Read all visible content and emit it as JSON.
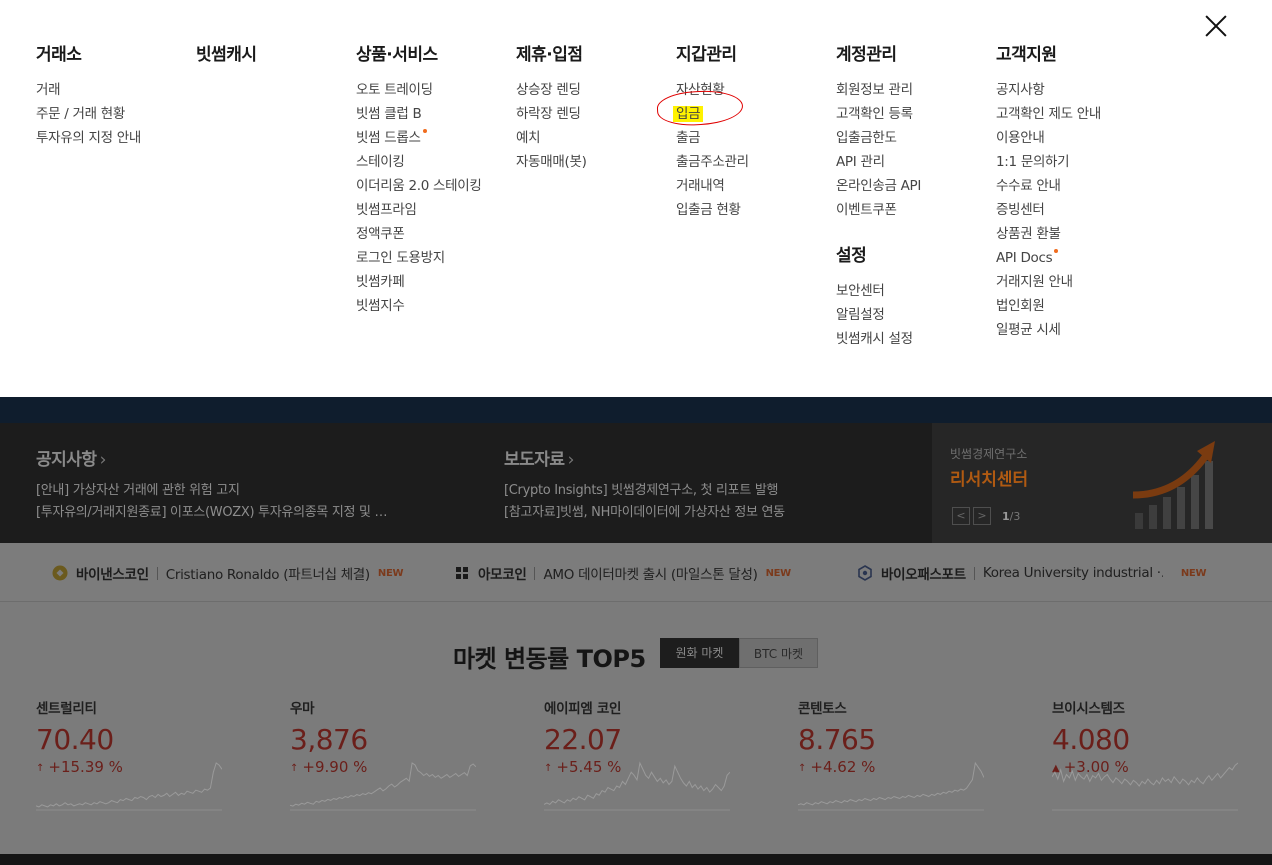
{
  "menu": {
    "columns": [
      {
        "title": "거래소",
        "items": [
          "거래",
          "주문 / 거래 현황",
          "투자유의 지정 안내"
        ]
      },
      {
        "title": "빗썸캐시",
        "items": []
      },
      {
        "title": "상품·서비스",
        "items": [
          "오토 트레이딩",
          "빗썸 클럽 B",
          "빗썸 드롭스",
          "스테이킹",
          "이더리움 2.0 스테이킹",
          "빗썸프라임",
          "정액쿠폰",
          "로그인 도용방지",
          "빗썸카페",
          "빗썸지수"
        ]
      },
      {
        "title": "제휴·입점",
        "items": [
          "상승장 렌딩",
          "하락장 렌딩",
          "예치",
          "자동매매(봇)"
        ]
      },
      {
        "title": "지갑관리",
        "items": [
          "자산현황",
          "입금",
          "출금",
          "출금주소관리",
          "거래내역",
          "입출금 현황"
        ]
      },
      {
        "title": "계정관리",
        "items": [
          "회원정보 관리",
          "고객확인 등록",
          "입출금한도",
          "API 관리",
          "온라인송금 API",
          "이벤트쿠폰"
        ],
        "sub_title": "설정",
        "sub_items": [
          "보안센터",
          "알림설정",
          "빗썸캐시 설정"
        ]
      },
      {
        "title": "고객지원",
        "items": [
          "공지사항",
          "고객확인 제도 안내",
          "이용안내",
          "1:1 문의하기",
          "수수료 안내",
          "증빙센터",
          "상품권 환불",
          "API Docs",
          "거래지원 안내",
          "법인회원",
          "일평균 시세"
        ]
      }
    ],
    "close_icon": "close-icon",
    "highlight_color": "#fff200",
    "annotation_color": "#e00000",
    "dot_color": "#f06c1e"
  },
  "news": {
    "notice": {
      "title": "공지사항",
      "lines": [
        "[안내] 가상자산 거래에 관한 위험 고지",
        "[투자유의/거래지원종료] 이포스(WOZX) 투자유의종목 지정 및 …"
      ]
    },
    "press": {
      "title": "보도자료",
      "lines": [
        "[Crypto Insights] 빗썸경제연구소, 첫 리포트 발행",
        "[참고자료]빗썸, NH마이데이터에 가상자산 정보 연동"
      ]
    },
    "research": {
      "small": "빗썸경제연구소",
      "big": "리서치센터",
      "page_current": "1",
      "page_total": "/3",
      "prev": "<",
      "next": ">"
    }
  },
  "ticker": [
    {
      "name": "바이낸스코인",
      "text": "Cristiano Ronaldo (파트너십 체결)",
      "badge": "NEW",
      "icon": "binance-coin-icon"
    },
    {
      "name": "아모코인",
      "text": "AMO 데이터마켓 출시 (마일스톤 달성)",
      "badge": "NEW",
      "icon": "amo-coin-icon"
    },
    {
      "name": "바이오패스포트",
      "text": "Korea University industrial ·…",
      "badge": "NEW",
      "icon": "biopassport-icon"
    }
  ],
  "market": {
    "title": "마켓 변동률 TOP5",
    "tabs": [
      "원화 마켓",
      "BTC 마켓"
    ],
    "coins": [
      {
        "name": "센트럴리티",
        "price": "70.40",
        "change": "+15.39 %",
        "arrow": "↑",
        "spark": [
          3,
          2,
          4,
          3,
          2,
          4,
          3,
          5,
          3,
          4,
          6,
          4,
          5,
          3,
          4,
          5,
          4,
          6,
          5,
          4,
          6,
          5,
          7,
          6,
          5,
          6,
          8,
          7,
          6,
          9,
          8,
          10,
          9,
          8,
          11,
          10,
          12,
          11,
          9,
          12,
          13,
          11,
          14,
          12,
          13,
          15,
          12,
          14,
          16,
          13,
          15,
          14,
          17,
          16,
          15,
          18,
          17,
          16,
          19,
          18,
          20,
          35,
          44,
          42,
          38
        ]
      },
      {
        "name": "우마",
        "price": "3,876",
        "change": "+9.90 %",
        "arrow": "↑",
        "spark": [
          4,
          3,
          5,
          4,
          6,
          5,
          7,
          6,
          5,
          8,
          7,
          9,
          8,
          10,
          9,
          11,
          10,
          12,
          11,
          13,
          12,
          14,
          13,
          15,
          14,
          16,
          15,
          17,
          16,
          18,
          20,
          22,
          19,
          21,
          24,
          26,
          23,
          25,
          28,
          30,
          32,
          29,
          48,
          46,
          40,
          38,
          35,
          37,
          34,
          36,
          33,
          35,
          32,
          34,
          36,
          33,
          35,
          37,
          34,
          36,
          38,
          35,
          45,
          47,
          44
        ]
      },
      {
        "name": "에이피엠 코인",
        "price": "22.07",
        "change": "+5.45 %",
        "arrow": "↑",
        "spark": [
          3,
          4,
          3,
          5,
          4,
          6,
          5,
          4,
          6,
          5,
          7,
          6,
          8,
          7,
          6,
          9,
          8,
          7,
          10,
          9,
          12,
          11,
          14,
          13,
          12,
          15,
          14,
          18,
          16,
          20,
          24,
          22,
          19,
          30,
          26,
          22,
          20,
          24,
          21,
          18,
          20,
          17,
          19,
          16,
          18,
          28,
          24,
          20,
          17,
          15,
          18,
          14,
          16,
          13,
          15,
          12,
          14,
          11,
          13,
          16,
          14,
          12,
          15,
          22,
          24
        ]
      },
      {
        "name": "콘텐토스",
        "price": "8.765",
        "change": "+4.62 %",
        "arrow": "↑",
        "spark": [
          4,
          5,
          4,
          6,
          5,
          4,
          6,
          5,
          7,
          6,
          5,
          7,
          6,
          8,
          7,
          6,
          8,
          7,
          9,
          8,
          7,
          9,
          8,
          10,
          9,
          8,
          10,
          9,
          11,
          10,
          9,
          11,
          10,
          12,
          11,
          10,
          12,
          11,
          13,
          12,
          11,
          13,
          12,
          14,
          13,
          12,
          14,
          13,
          15,
          14,
          16,
          15,
          17,
          16,
          18,
          17,
          19,
          18,
          20,
          24,
          28,
          44,
          40,
          36,
          30
        ]
      },
      {
        "name": "브이시스템즈",
        "price": "4.080",
        "change": "+3.00 %",
        "arrow": "▲",
        "spark": [
          28,
          32,
          26,
          34,
          24,
          30,
          27,
          33,
          25,
          31,
          28,
          26,
          30,
          24,
          29,
          27,
          31,
          25,
          28,
          30,
          26,
          23,
          27,
          25,
          22,
          26,
          24,
          21,
          25,
          23,
          20,
          24,
          22,
          26,
          23,
          21,
          25,
          22,
          27,
          24,
          26,
          23,
          28,
          25,
          22,
          26,
          24,
          21,
          25,
          23,
          27,
          24,
          22,
          26,
          29,
          25,
          28,
          31,
          27,
          30,
          33,
          36,
          34,
          38,
          40
        ]
      }
    ]
  }
}
